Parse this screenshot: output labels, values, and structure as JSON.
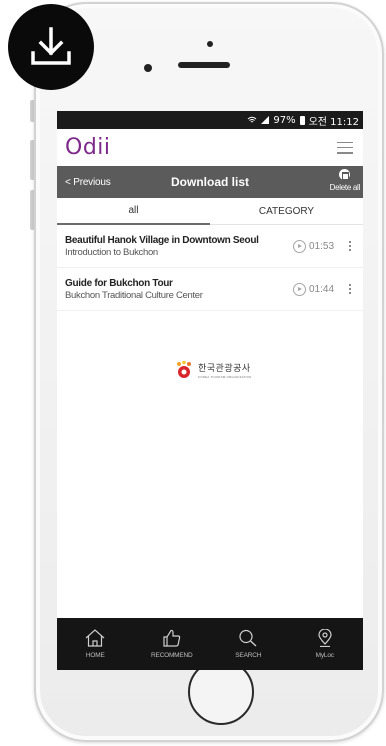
{
  "status_bar": {
    "battery": "97%",
    "time": "오전 11:12"
  },
  "header": {
    "logo": "Odii"
  },
  "nav": {
    "previous_label": "< Previous",
    "title": "Download list",
    "delete_all_label": "Delete all"
  },
  "tabs": [
    {
      "label": "all",
      "active": true
    },
    {
      "label": "CATEGORY",
      "active": false
    }
  ],
  "downloads": [
    {
      "title": "Beautiful Hanok Village in Downtown Seoul",
      "subtitle": "Introduction to Bukchon",
      "duration": "01:53"
    },
    {
      "title": "Guide for Bukchon Tour",
      "subtitle": "Bukchon Traditional Culture Center",
      "duration": "01:44"
    }
  ],
  "sponsor": {
    "name_ko": "한국관광공사",
    "name_en": "KOREA TOURISM ORGANIZATION"
  },
  "bottom_nav": [
    {
      "label": "HOME",
      "icon": "home-icon"
    },
    {
      "label": "RECOMMEND",
      "icon": "thumbs-up-icon"
    },
    {
      "label": "SEARCH",
      "icon": "search-icon"
    },
    {
      "label": "MyLoc",
      "icon": "location-pin-icon"
    }
  ],
  "colors": {
    "accent": "#7d2a8a",
    "navbar": "#5b5b5b",
    "tabbar": "#151515"
  }
}
